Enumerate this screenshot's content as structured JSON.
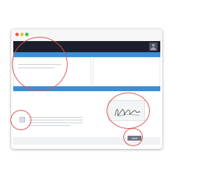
{
  "window": {
    "controls": [
      "close-icon",
      "minimize-icon",
      "maximize-icon"
    ]
  },
  "header": {
    "user_icon": "user-icon"
  },
  "form": {
    "signature_icon": "signature-icon",
    "next_label": "Next"
  },
  "highlights": {
    "color": "#d9534f"
  },
  "colors": {
    "header": "#1b1f2b",
    "accent_blue": "#3a8fd6",
    "close": "#ef5b4f",
    "minimize": "#f4bd36",
    "maximize": "#3cc24a"
  }
}
